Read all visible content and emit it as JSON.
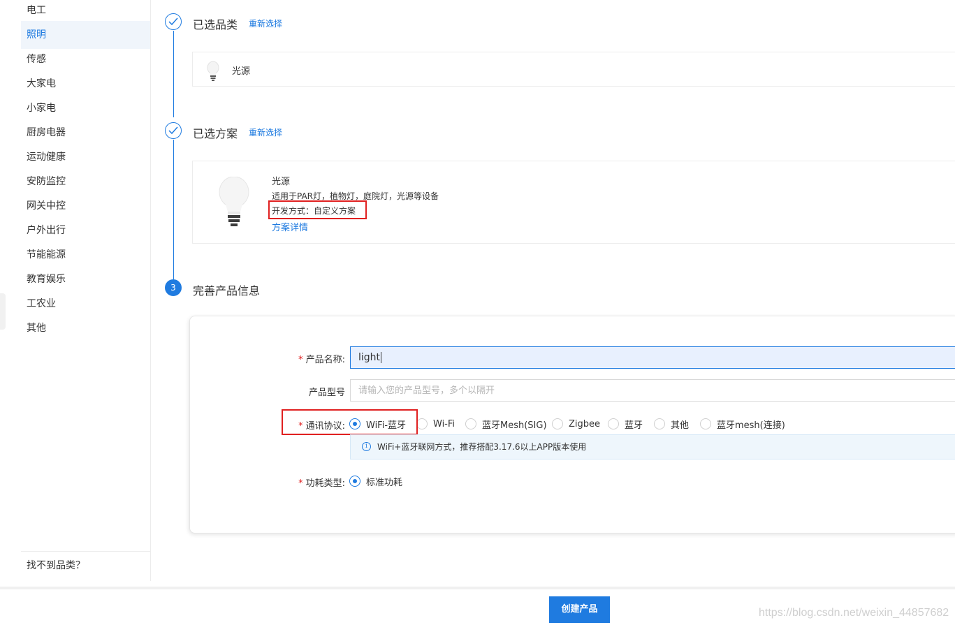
{
  "sidebar": {
    "categories": [
      "电工",
      "照明",
      "传感",
      "大家电",
      "小家电",
      "厨房电器",
      "运动健康",
      "安防监控",
      "网关中控",
      "户外出行",
      "节能能源",
      "教育娱乐",
      "工农业",
      "其他"
    ],
    "active_index": 1,
    "bottom_link": "找不到品类？"
  },
  "steps": {
    "step1": {
      "title": "已选品类",
      "reselect": "重新选择",
      "selected_label": "光源"
    },
    "step2": {
      "title": "已选方案",
      "reselect": "重新选择",
      "plan_title": "光源",
      "plan_desc": "适用于PAR灯，植物灯，庭院灯，光源等设备",
      "plan_dev": "开发方式：自定义方案",
      "plan_detail": "方案详情"
    },
    "step3": {
      "number": "3",
      "title": "完善产品信息"
    }
  },
  "form": {
    "required_mark": "*",
    "name_label": "产品名称:",
    "name_value": "light",
    "model_label": "产品型号",
    "model_placeholder": "请输入您的产品型号，多个以隔开",
    "protocol_label": "通讯协议:",
    "protocol_options": [
      "WiFi-蓝牙",
      "Wi-Fi",
      "蓝牙Mesh(SIG)",
      "Zigbee",
      "蓝牙",
      "其他",
      "蓝牙mesh(连接)"
    ],
    "protocol_selected": "WiFi-蓝牙",
    "protocol_info": "WiFi+蓝牙联网方式，推荐搭配3.17.6以上APP版本使用",
    "info_icon": "i",
    "power_label": "功耗类型:",
    "power_options": [
      "标准功耗"
    ],
    "power_selected": "标准功耗"
  },
  "footer": {
    "create_button": "创建产品",
    "watermark": "https://blog.csdn.net/weixin_44857682"
  },
  "colors": {
    "accent": "#1f7be0",
    "highlight_box": "#e02020",
    "active_bg": "#f0f5fb"
  }
}
